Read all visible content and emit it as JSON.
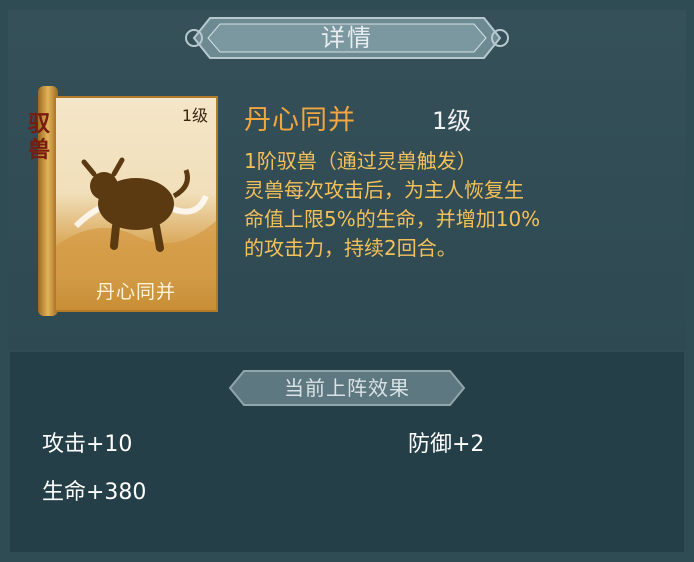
{
  "header": {
    "title": "详情"
  },
  "card": {
    "level": "1级",
    "name": "丹心同并",
    "tag": "驭兽"
  },
  "skill": {
    "name": "丹心同并",
    "level": "1级",
    "subtitle": "1阶驭兽（通过灵兽触发）",
    "desc_lines": [
      "灵兽每次攻击后，为主人恢复生",
      "命值上限5%的生命，并增加10%",
      "的攻击力，持续2回合。"
    ]
  },
  "effects": {
    "title": "当前上阵效果",
    "stats": [
      {
        "label": "攻击+10"
      },
      {
        "label": "防御+2"
      },
      {
        "label": "生命+380"
      }
    ]
  },
  "colors": {
    "accent_orange": "#f2a63c",
    "text_gold": "#f4c05a",
    "panel_teal": "#2f4b54"
  },
  "icons": {
    "beast": "ox-beast-icon"
  }
}
